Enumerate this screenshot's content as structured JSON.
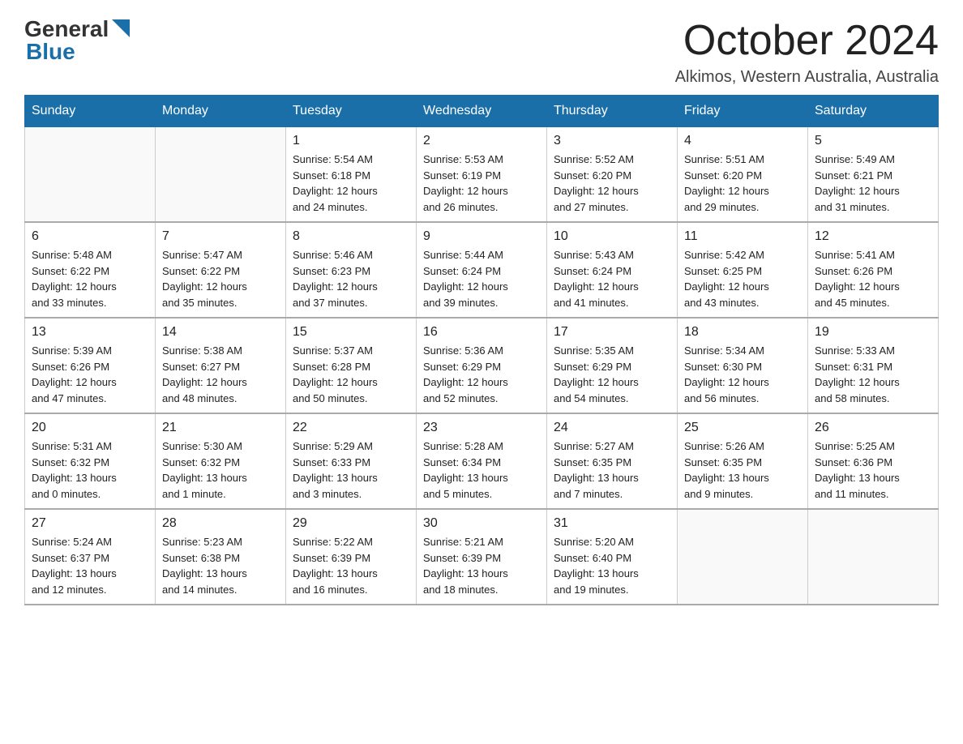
{
  "header": {
    "logo_general": "General",
    "logo_blue": "Blue",
    "month_title": "October 2024",
    "location": "Alkimos, Western Australia, Australia"
  },
  "calendar": {
    "days_of_week": [
      "Sunday",
      "Monday",
      "Tuesday",
      "Wednesday",
      "Thursday",
      "Friday",
      "Saturday"
    ],
    "weeks": [
      [
        {
          "day": "",
          "info": ""
        },
        {
          "day": "",
          "info": ""
        },
        {
          "day": "1",
          "info": "Sunrise: 5:54 AM\nSunset: 6:18 PM\nDaylight: 12 hours\nand 24 minutes."
        },
        {
          "day": "2",
          "info": "Sunrise: 5:53 AM\nSunset: 6:19 PM\nDaylight: 12 hours\nand 26 minutes."
        },
        {
          "day": "3",
          "info": "Sunrise: 5:52 AM\nSunset: 6:20 PM\nDaylight: 12 hours\nand 27 minutes."
        },
        {
          "day": "4",
          "info": "Sunrise: 5:51 AM\nSunset: 6:20 PM\nDaylight: 12 hours\nand 29 minutes."
        },
        {
          "day": "5",
          "info": "Sunrise: 5:49 AM\nSunset: 6:21 PM\nDaylight: 12 hours\nand 31 minutes."
        }
      ],
      [
        {
          "day": "6",
          "info": "Sunrise: 5:48 AM\nSunset: 6:22 PM\nDaylight: 12 hours\nand 33 minutes."
        },
        {
          "day": "7",
          "info": "Sunrise: 5:47 AM\nSunset: 6:22 PM\nDaylight: 12 hours\nand 35 minutes."
        },
        {
          "day": "8",
          "info": "Sunrise: 5:46 AM\nSunset: 6:23 PM\nDaylight: 12 hours\nand 37 minutes."
        },
        {
          "day": "9",
          "info": "Sunrise: 5:44 AM\nSunset: 6:24 PM\nDaylight: 12 hours\nand 39 minutes."
        },
        {
          "day": "10",
          "info": "Sunrise: 5:43 AM\nSunset: 6:24 PM\nDaylight: 12 hours\nand 41 minutes."
        },
        {
          "day": "11",
          "info": "Sunrise: 5:42 AM\nSunset: 6:25 PM\nDaylight: 12 hours\nand 43 minutes."
        },
        {
          "day": "12",
          "info": "Sunrise: 5:41 AM\nSunset: 6:26 PM\nDaylight: 12 hours\nand 45 minutes."
        }
      ],
      [
        {
          "day": "13",
          "info": "Sunrise: 5:39 AM\nSunset: 6:26 PM\nDaylight: 12 hours\nand 47 minutes."
        },
        {
          "day": "14",
          "info": "Sunrise: 5:38 AM\nSunset: 6:27 PM\nDaylight: 12 hours\nand 48 minutes."
        },
        {
          "day": "15",
          "info": "Sunrise: 5:37 AM\nSunset: 6:28 PM\nDaylight: 12 hours\nand 50 minutes."
        },
        {
          "day": "16",
          "info": "Sunrise: 5:36 AM\nSunset: 6:29 PM\nDaylight: 12 hours\nand 52 minutes."
        },
        {
          "day": "17",
          "info": "Sunrise: 5:35 AM\nSunset: 6:29 PM\nDaylight: 12 hours\nand 54 minutes."
        },
        {
          "day": "18",
          "info": "Sunrise: 5:34 AM\nSunset: 6:30 PM\nDaylight: 12 hours\nand 56 minutes."
        },
        {
          "day": "19",
          "info": "Sunrise: 5:33 AM\nSunset: 6:31 PM\nDaylight: 12 hours\nand 58 minutes."
        }
      ],
      [
        {
          "day": "20",
          "info": "Sunrise: 5:31 AM\nSunset: 6:32 PM\nDaylight: 13 hours\nand 0 minutes."
        },
        {
          "day": "21",
          "info": "Sunrise: 5:30 AM\nSunset: 6:32 PM\nDaylight: 13 hours\nand 1 minute."
        },
        {
          "day": "22",
          "info": "Sunrise: 5:29 AM\nSunset: 6:33 PM\nDaylight: 13 hours\nand 3 minutes."
        },
        {
          "day": "23",
          "info": "Sunrise: 5:28 AM\nSunset: 6:34 PM\nDaylight: 13 hours\nand 5 minutes."
        },
        {
          "day": "24",
          "info": "Sunrise: 5:27 AM\nSunset: 6:35 PM\nDaylight: 13 hours\nand 7 minutes."
        },
        {
          "day": "25",
          "info": "Sunrise: 5:26 AM\nSunset: 6:35 PM\nDaylight: 13 hours\nand 9 minutes."
        },
        {
          "day": "26",
          "info": "Sunrise: 5:25 AM\nSunset: 6:36 PM\nDaylight: 13 hours\nand 11 minutes."
        }
      ],
      [
        {
          "day": "27",
          "info": "Sunrise: 5:24 AM\nSunset: 6:37 PM\nDaylight: 13 hours\nand 12 minutes."
        },
        {
          "day": "28",
          "info": "Sunrise: 5:23 AM\nSunset: 6:38 PM\nDaylight: 13 hours\nand 14 minutes."
        },
        {
          "day": "29",
          "info": "Sunrise: 5:22 AM\nSunset: 6:39 PM\nDaylight: 13 hours\nand 16 minutes."
        },
        {
          "day": "30",
          "info": "Sunrise: 5:21 AM\nSunset: 6:39 PM\nDaylight: 13 hours\nand 18 minutes."
        },
        {
          "day": "31",
          "info": "Sunrise: 5:20 AM\nSunset: 6:40 PM\nDaylight: 13 hours\nand 19 minutes."
        },
        {
          "day": "",
          "info": ""
        },
        {
          "day": "",
          "info": ""
        }
      ]
    ]
  }
}
